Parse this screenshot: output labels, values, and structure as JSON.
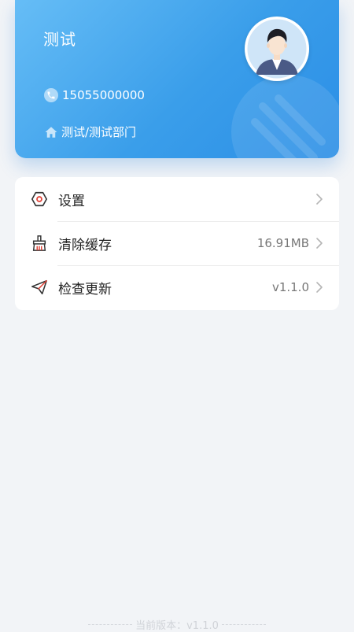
{
  "profile": {
    "name": "测试",
    "phone": "15055000000",
    "department": "测试/测试部门",
    "phone_icon": "phone-icon",
    "home_icon": "home-icon",
    "avatar_icon": "user-avatar"
  },
  "menu": {
    "items": [
      {
        "label": "设置",
        "value": "",
        "icon": "settings-hexagon-icon"
      },
      {
        "label": "清除缓存",
        "value": "16.91MB",
        "icon": "broom-icon"
      },
      {
        "label": "检查更新",
        "value": "v1.1.0",
        "icon": "paper-plane-icon"
      }
    ]
  },
  "footer": {
    "version_text": "当前版本：v1.1.0"
  },
  "colors": {
    "accent": "#3a9eea",
    "icon_red": "#e0453a",
    "background": "#f2f4f7"
  }
}
